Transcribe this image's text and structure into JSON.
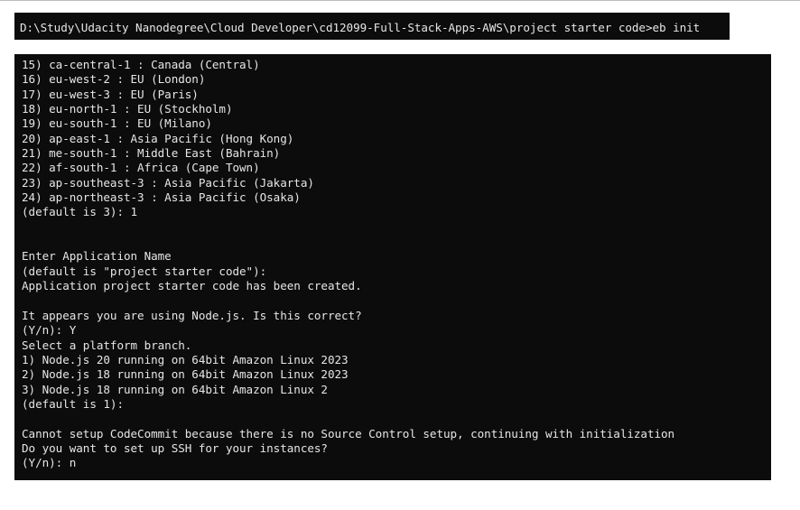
{
  "command_window": {
    "command_line": "D:\\Study\\Udacity Nanodegree\\Cloud Developer\\cd12099-Full-Stack-Apps-AWS\\project starter code>eb init"
  },
  "output_window": {
    "lines": [
      "15) ca-central-1 : Canada (Central)",
      "16) eu-west-2 : EU (London)",
      "17) eu-west-3 : EU (Paris)",
      "18) eu-north-1 : EU (Stockholm)",
      "19) eu-south-1 : EU (Milano)",
      "20) ap-east-1 : Asia Pacific (Hong Kong)",
      "21) me-south-1 : Middle East (Bahrain)",
      "22) af-south-1 : Africa (Cape Town)",
      "23) ap-southeast-3 : Asia Pacific (Jakarta)",
      "24) ap-northeast-3 : Asia Pacific (Osaka)",
      "(default is 3): 1",
      "",
      "",
      "Enter Application Name",
      "(default is \"project starter code\"):",
      "Application project starter code has been created.",
      "",
      "It appears you are using Node.js. Is this correct?",
      "(Y/n): Y",
      "Select a platform branch.",
      "1) Node.js 20 running on 64bit Amazon Linux 2023",
      "2) Node.js 18 running on 64bit Amazon Linux 2023",
      "3) Node.js 18 running on 64bit Amazon Linux 2",
      "(default is 1):",
      "",
      "Cannot setup CodeCommit because there is no Source Control setup, continuing with initialization",
      "Do you want to set up SSH for your instances?",
      "(Y/n): n"
    ]
  },
  "colors": {
    "terminal_background": "#0c0c0c",
    "terminal_text": "#e6e6e6",
    "page_background": "#ffffff"
  }
}
